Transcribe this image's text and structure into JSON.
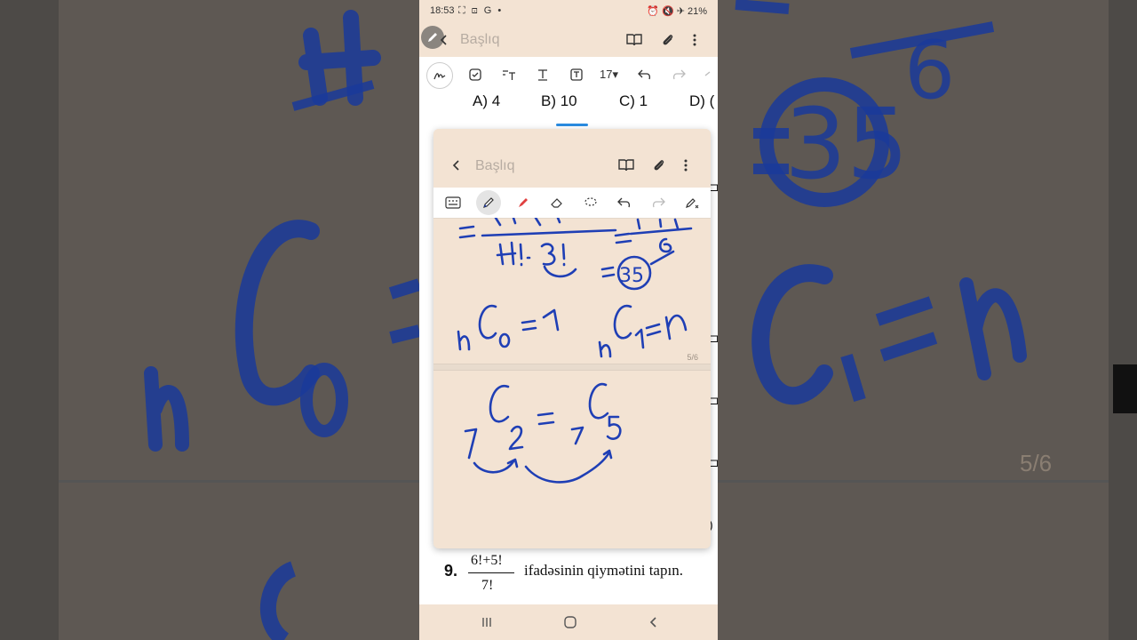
{
  "status_bar": {
    "time": "18:53",
    "left_icons": "⛶ ⊡ G •",
    "battery": "21%"
  },
  "top_bar": {
    "title": "Başlıq"
  },
  "toolbar": {
    "font_size": "17"
  },
  "answers": {
    "a": "A) 4",
    "b": "B) 10",
    "c": "C) 1",
    "d": "D) ("
  },
  "popup": {
    "title": "Başlıq",
    "page_indicator": "5/6"
  },
  "question": {
    "number": "9.",
    "numerator": "6!+5!",
    "denominator": "7!",
    "text": "ifadəsinin qiymətini tapın."
  },
  "colors": {
    "note_bg": "#f3e3d3",
    "ink": "#1f3fb5",
    "accent": "#2a8be0"
  },
  "icons": [
    "pen-icon",
    "book-icon",
    "attach-icon",
    "more-icon",
    "checkbox-icon",
    "text-style-icon",
    "text-icon",
    "textbox-icon",
    "undo-icon",
    "redo-icon",
    "keyboard-icon",
    "pencil-icon",
    "highlighter-icon",
    "eraser-icon",
    "lasso-icon",
    "pen-settings-icon",
    "recents-icon",
    "home-icon",
    "back-icon"
  ]
}
